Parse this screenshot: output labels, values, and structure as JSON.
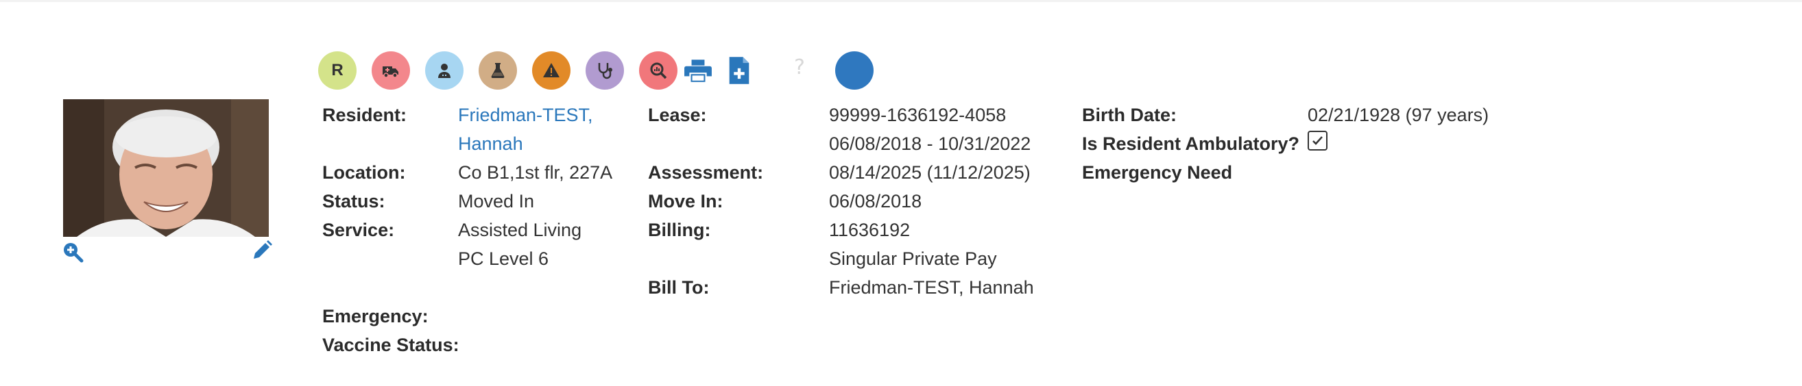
{
  "toolbar": {
    "icons": [
      {
        "name": "resident-badge",
        "letter": "R",
        "color": "#d4e38a"
      },
      {
        "name": "ambulance-icon",
        "color": "#f3878c"
      },
      {
        "name": "doctor-icon",
        "color": "#a7d6f2"
      },
      {
        "name": "lab-flask-icon",
        "color": "#d1ad86"
      },
      {
        "name": "warning-icon",
        "color": "#e28a28"
      },
      {
        "name": "stethoscope-icon",
        "color": "#b19bd0"
      },
      {
        "name": "search-chart-icon",
        "color": "#f1777b"
      },
      {
        "name": "printer-icon",
        "color": "#2a77bb"
      },
      {
        "name": "add-document-icon",
        "color": "#2a77bb"
      },
      {
        "name": "help-icon",
        "color": "#d8d8d8"
      },
      {
        "name": "status-dot",
        "color": "#2f78bf"
      }
    ],
    "help_glyph": "?"
  },
  "resident": {
    "labels": {
      "resident": "Resident:",
      "location": "Location:",
      "status": "Status:",
      "service": "Service:",
      "emergency": "Emergency:",
      "vaccine": "Vaccine Status:"
    },
    "name_line1": "Friedman-TEST,",
    "name_line2": "Hannah",
    "location": "Co B1,1st flr, 227A",
    "status": "Moved In",
    "service_line1": "Assisted Living",
    "service_line2": "PC Level 6"
  },
  "lease": {
    "labels": {
      "lease": "Lease:",
      "assessment": "Assessment:",
      "move_in": "Move In:",
      "billing": "Billing:",
      "bill_to": "Bill To:"
    },
    "lease_number": "99999-1636192-4058",
    "lease_period": "06/08/2018 - 10/31/2022",
    "assessment": "08/14/2025 (11/12/2025)",
    "move_in": "06/08/2018",
    "billing_number": "11636192",
    "billing_type": "Singular Private Pay",
    "bill_to": "Friedman-TEST, Hannah"
  },
  "personal": {
    "labels": {
      "birth_date": "Birth Date:",
      "ambulatory": "Is Resident Ambulatory?",
      "emergency_need": "Emergency Need"
    },
    "birth_date": "02/21/1928 (97 years)",
    "ambulatory_checked": true
  },
  "colors": {
    "link": "#2a77bb",
    "accent": "#2a77bb"
  }
}
